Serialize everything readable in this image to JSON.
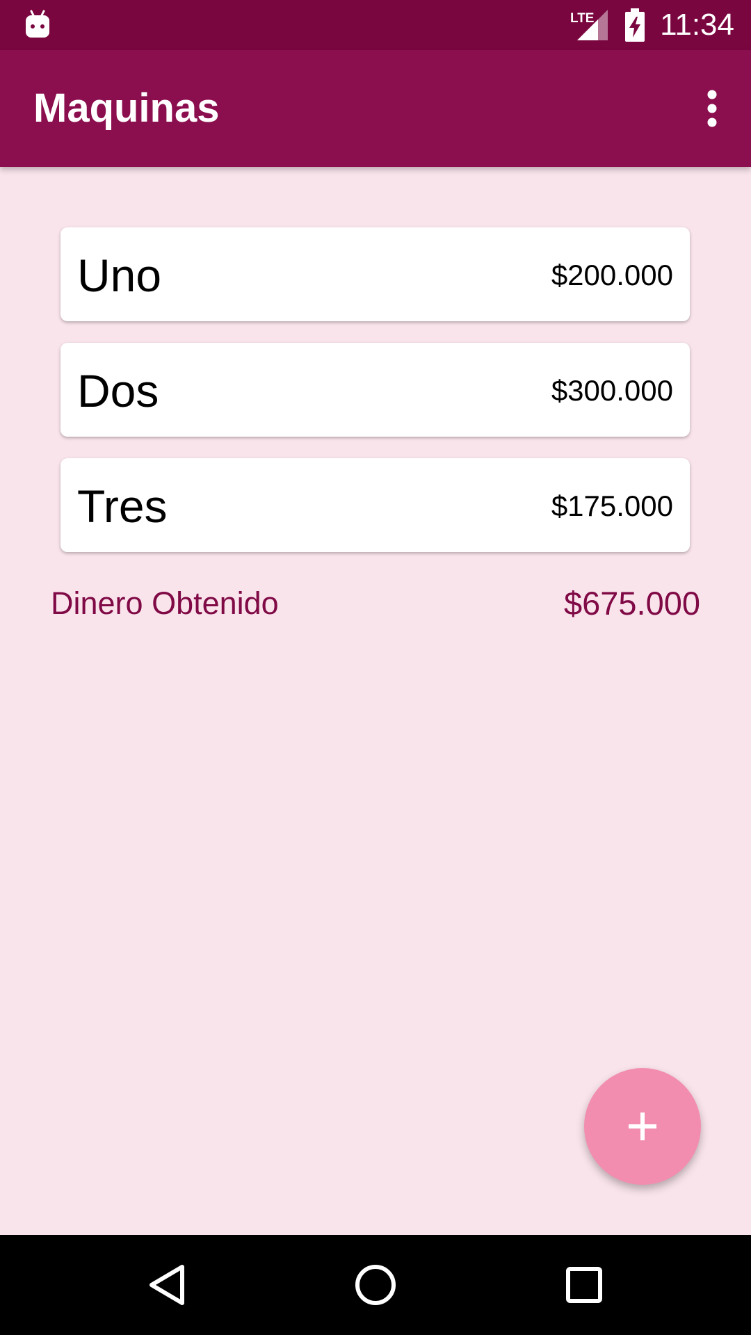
{
  "status_bar": {
    "time": "11:34",
    "network_label": "LTE",
    "icons": [
      "android-debug-icon",
      "lte-signal-icon",
      "battery-charging-icon"
    ]
  },
  "app_bar": {
    "title": "Maquinas",
    "menu_icon": "more-vertical-icon"
  },
  "machines": [
    {
      "name": "Uno",
      "amount": "$200.000"
    },
    {
      "name": "Dos",
      "amount": "$300.000"
    },
    {
      "name": "Tres",
      "amount": "$175.000"
    }
  ],
  "total": {
    "label": "Dinero Obtenido",
    "value": "$675.000"
  },
  "fab": {
    "icon": "plus-icon"
  },
  "nav_bar": {
    "icons": [
      "back-icon",
      "home-icon",
      "recents-icon"
    ]
  },
  "colors": {
    "status_bar": "#7a0640",
    "app_bar": "#8b0e4e",
    "background": "#fae4ec",
    "accent_text": "#800a46",
    "fab": "#f28db0"
  }
}
